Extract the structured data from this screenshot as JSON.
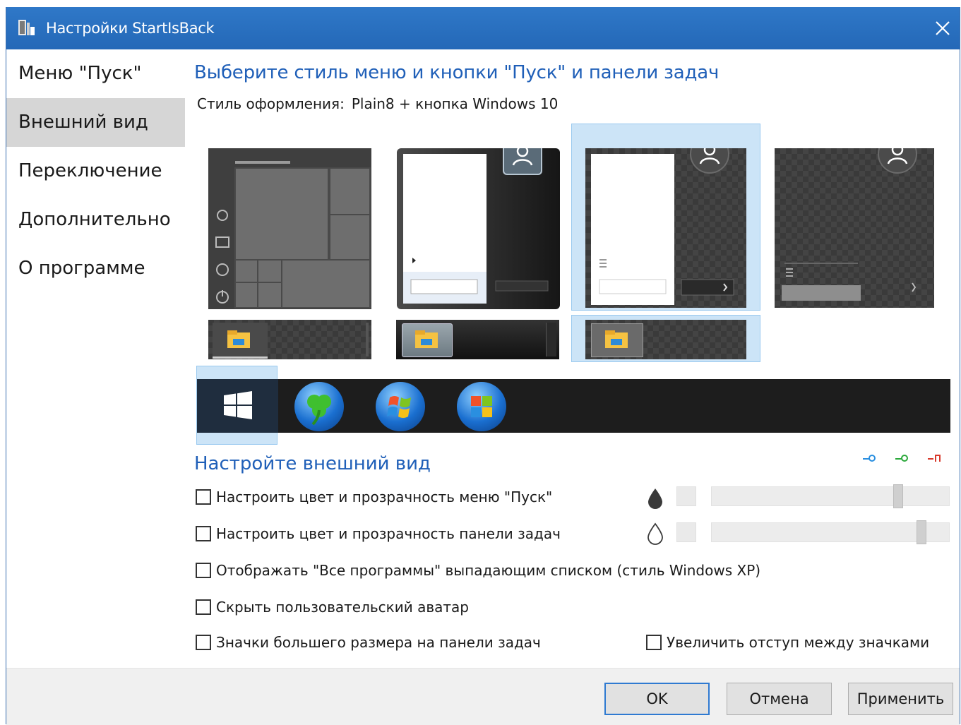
{
  "window": {
    "title": "Настройки StartIsBack"
  },
  "sidebar": {
    "items": [
      {
        "label": "Меню \"Пуск\""
      },
      {
        "label": "Внешний вид"
      },
      {
        "label": "Переключение"
      },
      {
        "label": "Дополнительно"
      },
      {
        "label": "О программе"
      }
    ],
    "active_index": 1
  },
  "style_section": {
    "heading": "Выберите стиль меню и кнопки \"Пуск\" и панели задач",
    "style_label": "Стиль оформления:",
    "style_value": "Plain8 + кнопка Windows 10",
    "menu_styles_count_visible": 4,
    "selected_menu_style": 3,
    "selected_taskbar_style": 3,
    "selected_start_button": 1
  },
  "appearance_section": {
    "heading": "Настройте внешний вид",
    "options": [
      {
        "label": "Настроить цвет и прозрачность меню \"Пуск\"",
        "checked": false
      },
      {
        "label": "Настроить цвет и прозрачность панели задач",
        "checked": false
      },
      {
        "label": "Отображать \"Все программы\" выпадающим списком (стиль Windows XP)",
        "checked": false
      },
      {
        "label": "Скрыть пользовательский аватар",
        "checked": false
      },
      {
        "label": "Значки большего размера на панели задач",
        "checked": false
      },
      {
        "label": "Увеличить отступ между значками",
        "checked": false
      }
    ],
    "menu_opacity": 0.78,
    "taskbar_opacity": 0.88
  },
  "footer": {
    "ok": "OK",
    "cancel": "Отмена",
    "apply": "Применить"
  },
  "colors": {
    "titlebar": "#2a70c0",
    "accent_text": "#1f5fb8",
    "selection_fill": "#cce4f7",
    "selection_border": "#99c9ef"
  }
}
